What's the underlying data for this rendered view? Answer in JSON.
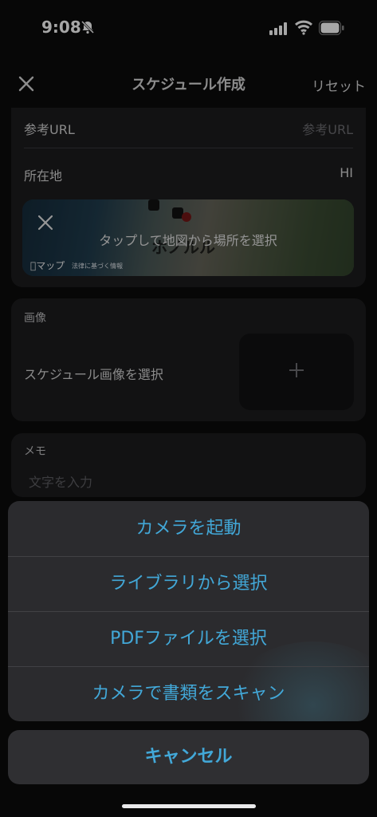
{
  "status": {
    "time": "9:08"
  },
  "header": {
    "title": "スケジュール作成",
    "reset": "リセット"
  },
  "form": {
    "reference_url_label": "参考URL",
    "reference_url_placeholder": "参考URL",
    "location_label": "所在地",
    "location_value": "HI",
    "map_hint": "タップして地図から場所を選択",
    "map_city": "ホノルル",
    "map_brand": "マップ",
    "map_legal": "法律に基づく情報",
    "image_section": "画像",
    "image_select_label": "スケジュール画像を選択",
    "memo_section": "メモ",
    "memo_placeholder": "文字を入力"
  },
  "action_sheet": {
    "items": [
      "カメラを起動",
      "ライブラリから選択",
      "PDFファイルを選択",
      "カメラで書類をスキャン"
    ],
    "cancel": "キャンセル"
  },
  "colors": {
    "accent": "#42a8d8",
    "card": "#1c1c1e",
    "sheet": "#2b2b2e"
  }
}
